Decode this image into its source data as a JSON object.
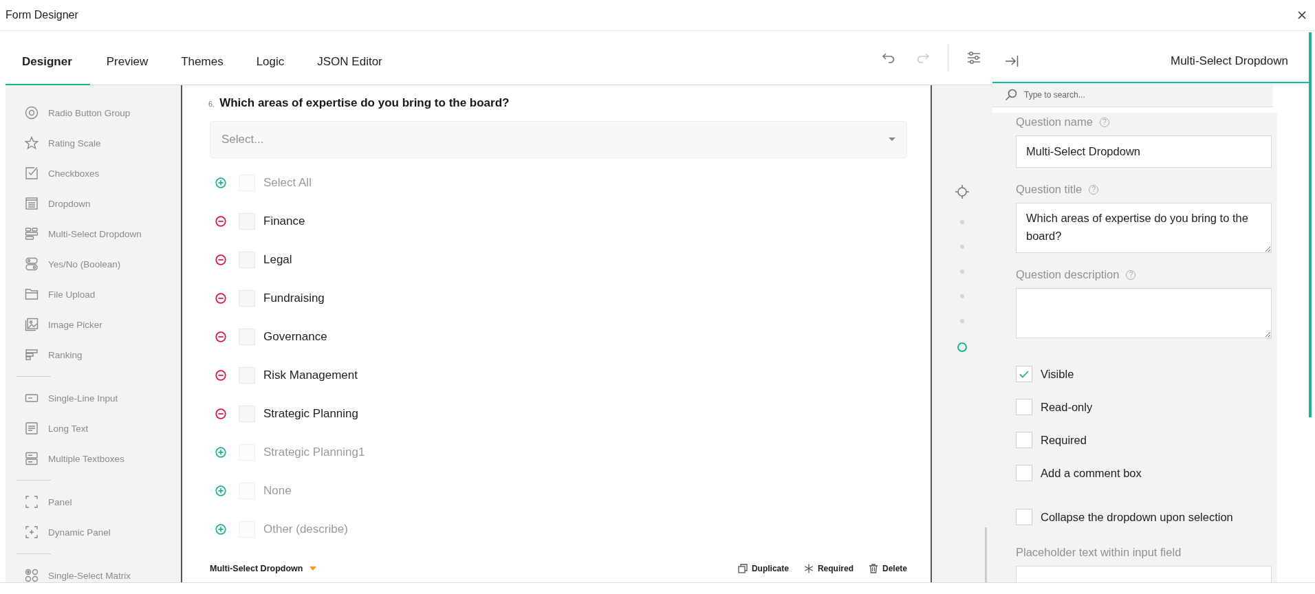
{
  "window": {
    "title": "Form Designer"
  },
  "tabs": [
    {
      "label": "Designer",
      "selected": true
    },
    {
      "label": "Preview",
      "selected": false
    },
    {
      "label": "Themes",
      "selected": false
    },
    {
      "label": "Logic",
      "selected": false
    },
    {
      "label": "JSON Editor",
      "selected": false
    }
  ],
  "toolbar": {
    "undo": {
      "disabled": false
    },
    "redo": {
      "disabled": true
    }
  },
  "toolbox": {
    "groups": [
      {
        "items": [
          {
            "kind": "radio",
            "label": "Radio Button Group"
          },
          {
            "kind": "rating",
            "label": "Rating Scale"
          },
          {
            "kind": "checkbox",
            "label": "Checkboxes"
          },
          {
            "kind": "dropdown",
            "label": "Dropdown"
          },
          {
            "kind": "tagbox",
            "label": "Multi-Select Dropdown"
          },
          {
            "kind": "boolean",
            "label": "Yes/No (Boolean)"
          },
          {
            "kind": "file",
            "label": "File Upload"
          },
          {
            "kind": "image",
            "label": "Image Picker"
          },
          {
            "kind": "ranking",
            "label": "Ranking"
          }
        ]
      },
      {
        "items": [
          {
            "kind": "text",
            "label": "Single-Line Input"
          },
          {
            "kind": "comment",
            "label": "Long Text"
          },
          {
            "kind": "multipletext",
            "label": "Multiple Textboxes"
          }
        ]
      },
      {
        "items": [
          {
            "kind": "panel",
            "label": "Panel"
          },
          {
            "kind": "paneldynamic",
            "label": "Dynamic Panel"
          }
        ]
      },
      {
        "items": [
          {
            "kind": "matrix",
            "label": "Single-Select Matrix"
          }
        ]
      }
    ]
  },
  "question": {
    "number": "6.",
    "title": "Which areas of expertise do you bring to the board?",
    "placeholder": "Select...",
    "choices": [
      {
        "label": "Select All",
        "included": false,
        "checked": false
      },
      {
        "label": "Finance",
        "included": true,
        "checked": false
      },
      {
        "label": "Legal",
        "included": true,
        "checked": false
      },
      {
        "label": "Fundraising",
        "included": true,
        "checked": false
      },
      {
        "label": "Governance",
        "included": true,
        "checked": false
      },
      {
        "label": "Risk Management",
        "included": true,
        "checked": false
      },
      {
        "label": "Strategic Planning",
        "included": true,
        "checked": false
      },
      {
        "label": "Strategic Planning1",
        "included": false,
        "checked": false
      },
      {
        "label": "None",
        "included": false,
        "checked": false
      },
      {
        "label": "Other (describe)",
        "included": false,
        "checked": false
      }
    ],
    "type_label": "Multi-Select Dropdown",
    "actions": [
      {
        "kind": "duplicate",
        "label": "Duplicate"
      },
      {
        "kind": "required",
        "label": "Required"
      },
      {
        "kind": "delete",
        "label": "Delete"
      }
    ]
  },
  "navigator": {
    "pages": [
      {
        "selected": false
      },
      {
        "selected": false
      },
      {
        "selected": false
      },
      {
        "selected": false
      },
      {
        "selected": false
      },
      {
        "selected": true
      }
    ]
  },
  "properties": {
    "title": "Multi-Select Dropdown",
    "search_placeholder": "Type to search...",
    "fields": [
      {
        "kind": "text",
        "label": "Question name",
        "help": "?",
        "value": "Multi-Select Dropdown"
      },
      {
        "kind": "textarea",
        "label": "Question title",
        "help": "?",
        "value": "Which areas of expertise do you bring to the board?"
      },
      {
        "kind": "textarea",
        "label": "Question description",
        "help": "?"
      }
    ],
    "checks": [
      {
        "label": "Visible",
        "checked": true
      },
      {
        "label": "Read-only",
        "checked": false
      },
      {
        "label": "Required",
        "checked": false
      },
      {
        "label": "Add a comment box",
        "checked": false
      }
    ],
    "dropdown_checks": [
      {
        "label": "Collapse the dropdown upon selection",
        "checked": false
      }
    ],
    "placeholder_field": {
      "label": "Placeholder text within input field"
    }
  }
}
